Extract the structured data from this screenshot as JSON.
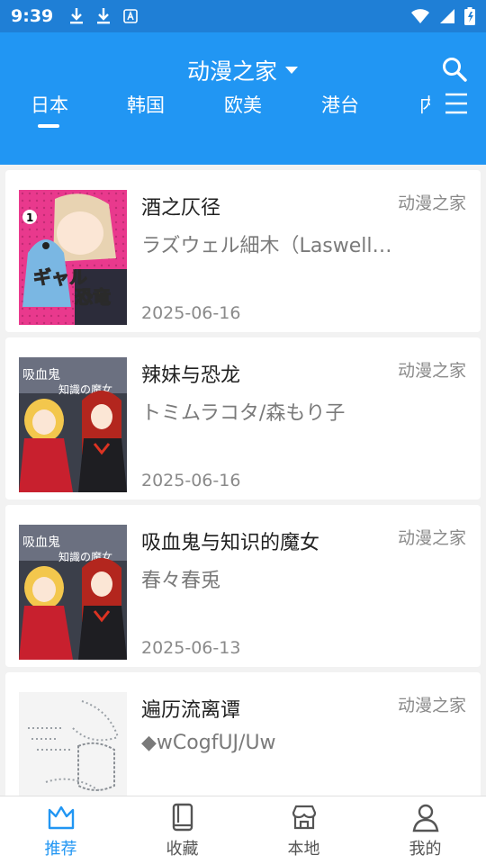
{
  "status": {
    "time": "9:39",
    "bar_color": "#1f7fd6"
  },
  "appbar": {
    "title": "动漫之家",
    "color": "#2196f3",
    "search_icon": "search-icon",
    "dropdown_icon": "caret-down-icon",
    "menu_icon": "menu-icon"
  },
  "tabs": [
    {
      "label": "日本",
      "active": true
    },
    {
      "label": "韩国",
      "active": false
    },
    {
      "label": "欧美",
      "active": false
    },
    {
      "label": "港台",
      "active": false
    },
    {
      "label": "内",
      "active": false
    }
  ],
  "comics": [
    {
      "title": "酒之仄径",
      "source": "动漫之家",
      "author": "ラズウェル細木（Laswell Hosoki）",
      "date": "2025-06-16"
    },
    {
      "title": "辣妹与恐龙",
      "source": "动漫之家",
      "author": "トミムラコタ/森もり子",
      "date": "2025-06-16"
    },
    {
      "title": "吸血鬼与知识的魔女",
      "source": "动漫之家",
      "author": "春々春兎",
      "date": "2025-06-13"
    },
    {
      "title": "遍历流离谭",
      "source": "动漫之家",
      "author": "◆wCogfUJ/Uw",
      "date": ""
    }
  ],
  "bottom_nav": [
    {
      "label": "推荐",
      "icon": "crown-icon",
      "active": true
    },
    {
      "label": "收藏",
      "icon": "book-icon",
      "active": false
    },
    {
      "label": "本地",
      "icon": "store-icon",
      "active": false
    },
    {
      "label": "我的",
      "icon": "user-icon",
      "active": false
    }
  ],
  "accent_color": "#2196f3"
}
